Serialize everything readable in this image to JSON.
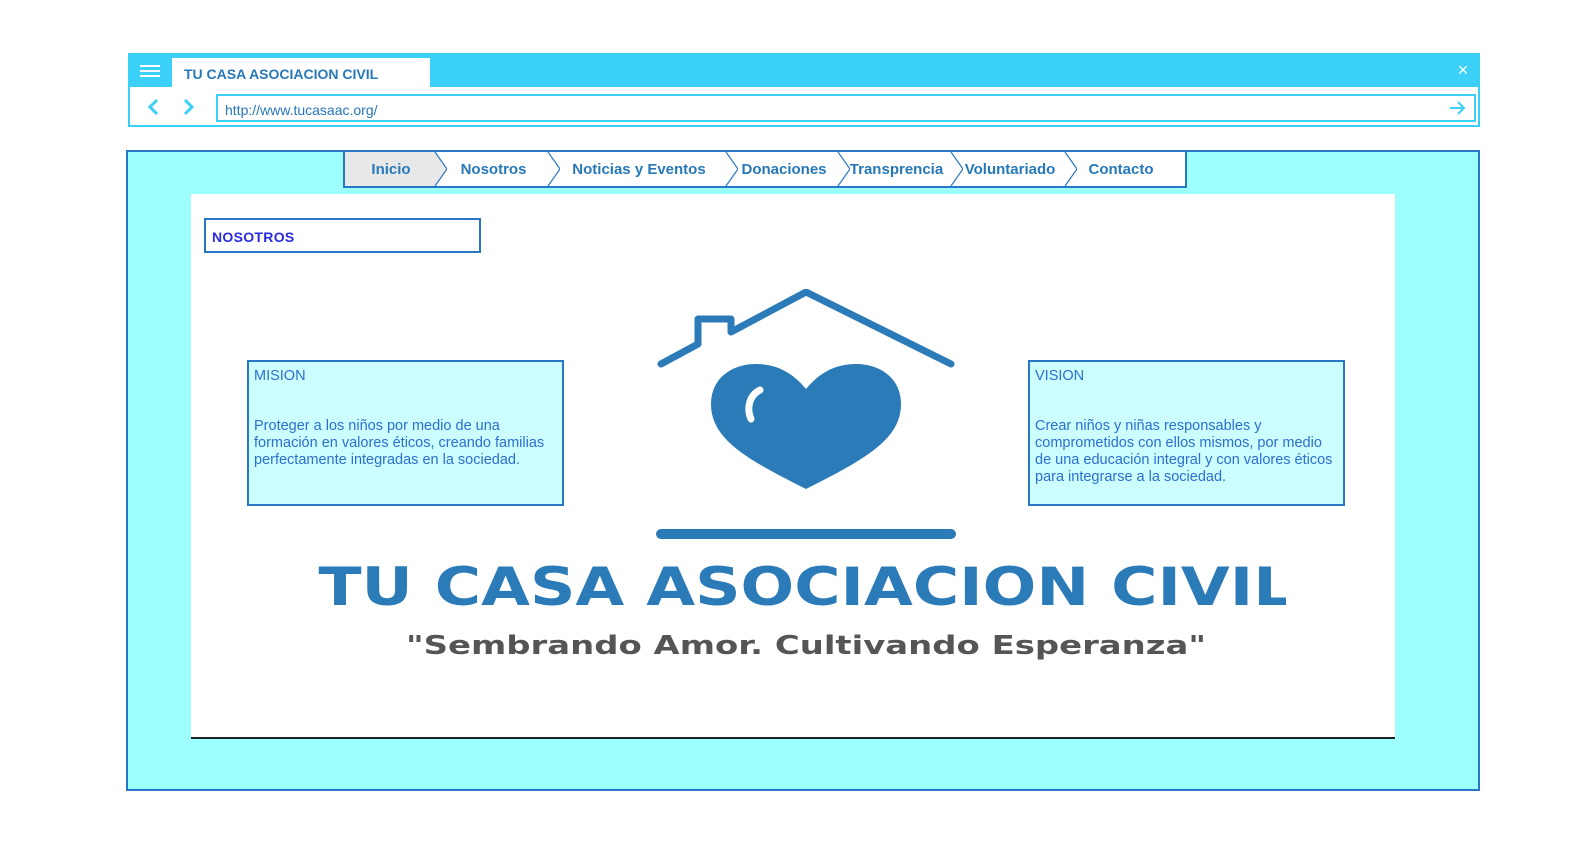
{
  "browser": {
    "tab_title": "TU CASA ASOCIACION CIVIL",
    "url": "http://www.tucasaac.org/",
    "close_glyph": "×",
    "icons": [
      "menu-icon",
      "back-arrow-icon",
      "forward-arrow-icon",
      "go-arrow-icon"
    ]
  },
  "nav": {
    "items": [
      {
        "label": "Inicio"
      },
      {
        "label": "Nosotros"
      },
      {
        "label": "Noticias y Eventos"
      },
      {
        "label": "Donaciones"
      },
      {
        "label": "Transprencia"
      },
      {
        "label": "Voluntariado"
      },
      {
        "label": "Contacto"
      }
    ]
  },
  "section": {
    "title": "NOSOTROS"
  },
  "logo": {
    "name": "TU CASA ASOCIACION CIVIL",
    "slogan": "\"Sembrando Amor. Cultivando Esperanza\""
  },
  "mision": {
    "title": "MISION",
    "text": "Proteger a los niños por medio de una formación en valores éticos, creando familias perfectamente integradas en la sociedad."
  },
  "vision": {
    "title": "VISION",
    "text": "Crear niños y niñas responsables y comprometidos con ellos mismos, por medio de una educación integral y con valores éticos para integrarse a la sociedad."
  },
  "colors": {
    "chrome": "#3ad0f8",
    "page_bg": "#9cfffd",
    "border": "#2877c4",
    "logo_blue": "#2a7bb8",
    "slogan_gray": "#555555"
  }
}
